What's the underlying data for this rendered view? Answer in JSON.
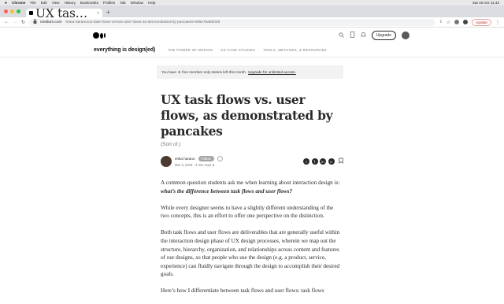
{
  "menubar": {
    "apple": "",
    "app": "Chrome",
    "items": [
      "File",
      "Edit",
      "View",
      "History",
      "Bookmarks",
      "Profiles",
      "Tab",
      "Window",
      "Help"
    ],
    "clock": "Sat 16 Oct 11:42"
  },
  "tab": {
    "title": "UX task flows vs. user flows, a...",
    "close": "×",
    "new_tab": "+"
  },
  "address": {
    "host": "medium.com",
    "path": "/erika-harano/ux-task-flows-versus-user-flows-as-demonstrated-by-pancakes-696e78a86026",
    "update_label": "Update"
  },
  "medium": {
    "upgrade_label": "Upgrade"
  },
  "publication": {
    "name": "everything is design(ed)",
    "nav": [
      "THE POWER OF DESIGN",
      "UX CASE STUDIES",
      "TOOLS, METHODS, & RESOURCES"
    ]
  },
  "banner": {
    "prefix": "You have",
    "count": "3",
    "suffix": "free member-only stories left this month.",
    "link": "Upgrade for unlimited access."
  },
  "article": {
    "title": "UX task flows vs. user flows, as demonstrated by pancakes",
    "subtitle": "(Sort of.)",
    "author": "erika harano",
    "follow_label": "Follow",
    "date": "Mar 3, 2019",
    "read_time": "4 min read",
    "star": "★",
    "p1_start": "A common question students ask me when learning about interaction design is:",
    "p1_question": "what’s the difference between task flows and user flows?",
    "p2": "While every designer seems to have a slightly different understanding of the two concepts, this is an effort to offer one perspective on the distinction.",
    "p3": "Both task flows and user flows are deliverables that are generally useful within the interaction design phase of UX design processes, wherein we map out the structure, hierarchy, organization, and relationships across content and features of our designs, so that people who use the design (e.g. a product, service, experience) can fluidly navigate through the design to accomplish their desired goals.",
    "p4": "Here’s how I differentiate between task flows and user flows: task flows"
  },
  "social_icons": [
    "twitter-icon",
    "facebook-icon",
    "linkedin-icon",
    "link-icon",
    "bookmark-icon"
  ],
  "colors": {
    "text": "#292929",
    "muted": "#757575",
    "banner_bg": "#f2f2f2",
    "update_red": "#c5221f"
  }
}
